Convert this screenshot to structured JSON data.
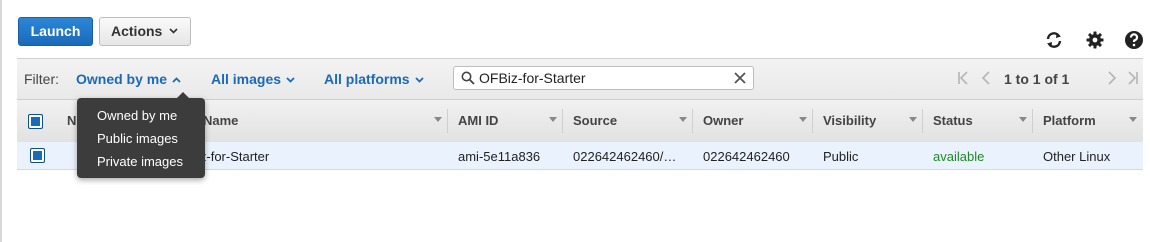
{
  "toolbar": {
    "launch_label": "Launch",
    "actions_label": "Actions"
  },
  "icons": [
    "refresh-icon",
    "gear-icon",
    "help-icon"
  ],
  "filter": {
    "label": "Filter:",
    "ownership": "Owned by me",
    "image_type": "All images",
    "platform": "All platforms",
    "search_value": "OFBiz-for-Starter",
    "pagination": "1 to 1 of 1"
  },
  "ownership_menu": [
    "Owned by me",
    "Public images",
    "Private images"
  ],
  "table": {
    "columns": [
      "Name",
      "AMI Name",
      "AMI ID",
      "Source",
      "Owner",
      "Visibility",
      "Status",
      "Platform"
    ],
    "visible_column_labels": [
      "N",
      "Name",
      "AMI ID",
      "Source",
      "Owner",
      "Visibility",
      "Status",
      "Platform"
    ],
    "rows": [
      {
        "name": "",
        "ami_name_visible": "iz-for-Starter",
        "ami_id": "ami-5e11a836",
        "source": "022642462460/…",
        "owner": "022642462460",
        "visibility": "Public",
        "status": "available",
        "platform": "Other Linux",
        "selected": true
      }
    ]
  },
  "colors": {
    "accent": "#1b6ab9",
    "status_available": "#1e8a24",
    "menu_background": "#3c3c3c",
    "selected_row": "#eaf3fd"
  }
}
